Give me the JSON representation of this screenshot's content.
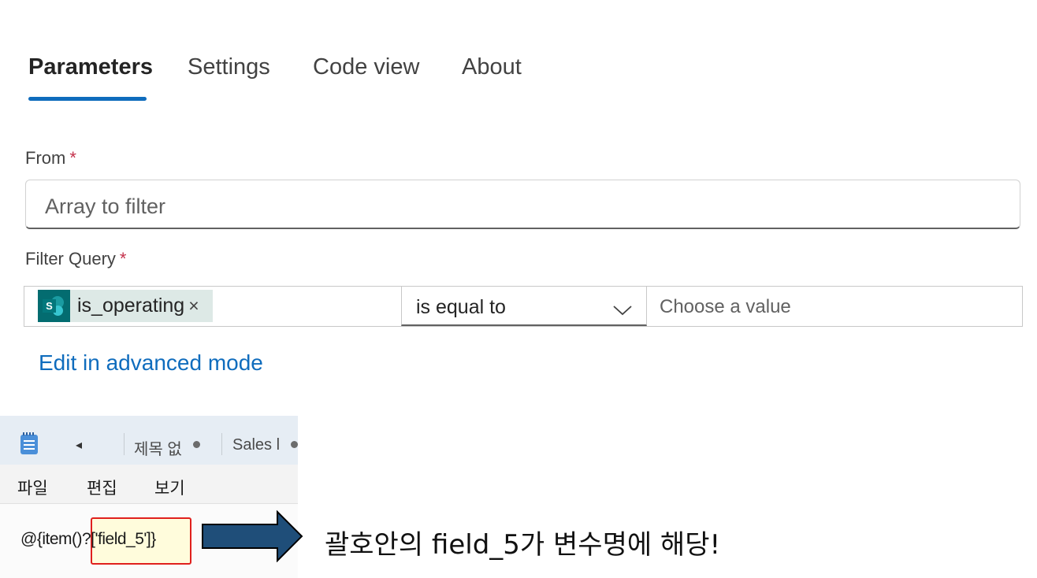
{
  "tabs": [
    {
      "label": "Parameters",
      "active": true
    },
    {
      "label": "Settings",
      "active": false
    },
    {
      "label": "Code view",
      "active": false
    },
    {
      "label": "About",
      "active": false
    }
  ],
  "from": {
    "label": "From",
    "required_mark": "*",
    "placeholder": "Array to filter"
  },
  "filter_query": {
    "label": "Filter Query",
    "required_mark": "*",
    "token": {
      "label": "is_operating",
      "remove": "×",
      "icon": "sharepoint-icon",
      "icon_letter": "S"
    },
    "operator": "is equal to",
    "value_placeholder": "Choose a value"
  },
  "advanced_link": "Edit in advanced mode",
  "notepad": {
    "tabs": [
      "제목 없",
      "Sales l"
    ],
    "back_glyph": "◂",
    "menu": [
      "파일",
      "편집",
      "보기"
    ],
    "content_prefix": "@{item()",
    "content_highlight": "?['field_5']",
    "content_suffix": "}"
  },
  "annotation": "괄호안의 field_5가 변수명에 해당!",
  "colors": {
    "accent": "#0f6cbd",
    "required": "#c4314b",
    "token_bg": "#dde9e6",
    "sharepoint": "#036c70",
    "highlight_border": "#e0201d",
    "arrow": "#1f4e79"
  }
}
